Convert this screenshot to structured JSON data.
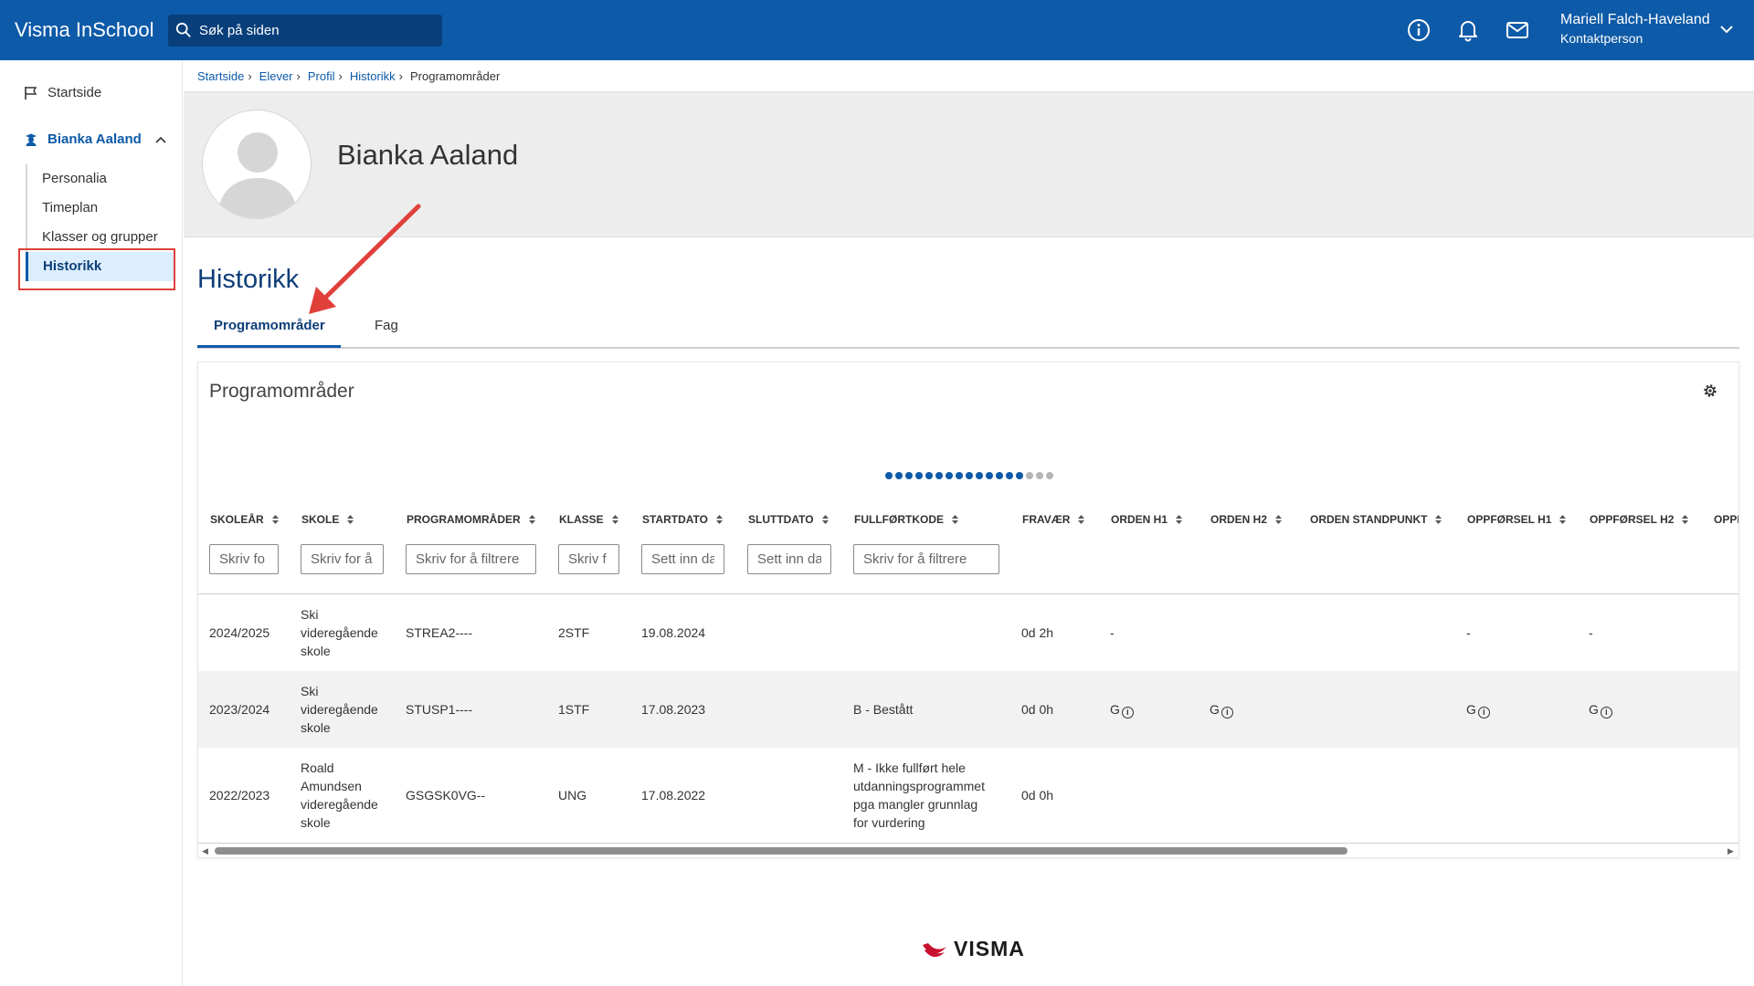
{
  "app": {
    "title": "Visma InSchool"
  },
  "search": {
    "placeholder": "Søk på siden"
  },
  "user": {
    "name": "Mariell Falch-Haveland",
    "role": "Kontaktperson"
  },
  "icons": {
    "info": "info-icon",
    "notifications": "bell-icon",
    "messages": "mail-icon",
    "settings": "gear-icon",
    "collapse": "double-chevron-left-icon"
  },
  "colors": {
    "brand": "#0d5aa8",
    "highlight": "#e0403a",
    "active_bg": "#dceefd"
  },
  "sidebar": {
    "start": "Startside",
    "student": "Bianka Aaland",
    "items": [
      "Personalia",
      "Timeplan",
      "Klasser og grupper",
      "Historikk"
    ]
  },
  "breadcrumb": [
    "Startside",
    "Elever",
    "Profil",
    "Historikk",
    "Programområder"
  ],
  "profile": {
    "name": "Bianka Aaland"
  },
  "page": {
    "title": "Historikk"
  },
  "tabs": [
    "Programområder",
    "Fag"
  ],
  "card": {
    "title": "Programområder"
  },
  "table": {
    "columns": [
      "SKOLEÅR",
      "SKOLE",
      "PROGRAMOMRÅDER",
      "KLASSE",
      "STARTDATO",
      "SLUTTDATO",
      "FULLFØRTKODE",
      "FRAVÆR",
      "ORDEN H1",
      "ORDEN H2",
      "ORDEN STANDPUNKT",
      "OPPFØRSEL H1",
      "OPPFØRSEL H2",
      "OPPF"
    ],
    "filters": [
      "Skriv fo",
      "Skriv for å",
      "Skriv for å filtrere",
      "Skriv f",
      "Sett inn da",
      "Sett inn da",
      "Skriv for å filtrere"
    ],
    "rows": [
      {
        "year": "2024/2025",
        "school": [
          "Ski",
          "videregående",
          "skole"
        ],
        "program": "STREA2----",
        "class": "2STF",
        "start": "19.08.2024",
        "end": "",
        "code": [],
        "absence": "0d 2h",
        "orden_h1": "-",
        "orden_h2": "",
        "orden_sp": "",
        "opp_h1": "-",
        "opp_h2": "-"
      },
      {
        "year": "2023/2024",
        "school": [
          "Ski",
          "videregående",
          "skole"
        ],
        "program": "STUSP1----",
        "class": "1STF",
        "start": "17.08.2023",
        "end": "",
        "code": [
          "B - Bestått"
        ],
        "absence": "0d 0h",
        "orden_h1": "G",
        "orden_h2": "G",
        "orden_sp": "",
        "opp_h1": "G",
        "opp_h2": "G"
      },
      {
        "year": "2022/2023",
        "school": [
          "Roald",
          "Amundsen",
          "videregående",
          "skole"
        ],
        "program": "GSGSK0VG--",
        "class": "UNG",
        "start": "17.08.2022",
        "end": "",
        "code": [
          "M - Ikke fullført hele",
          "utdanningsprogrammet",
          "pga mangler grunnlag",
          "for vurdering"
        ],
        "absence": "0d 0h",
        "orden_h1": "",
        "orden_h2": "",
        "orden_sp": "",
        "opp_h1": "",
        "opp_h2": ""
      }
    ]
  },
  "footer": {
    "brand": "VISMA"
  }
}
